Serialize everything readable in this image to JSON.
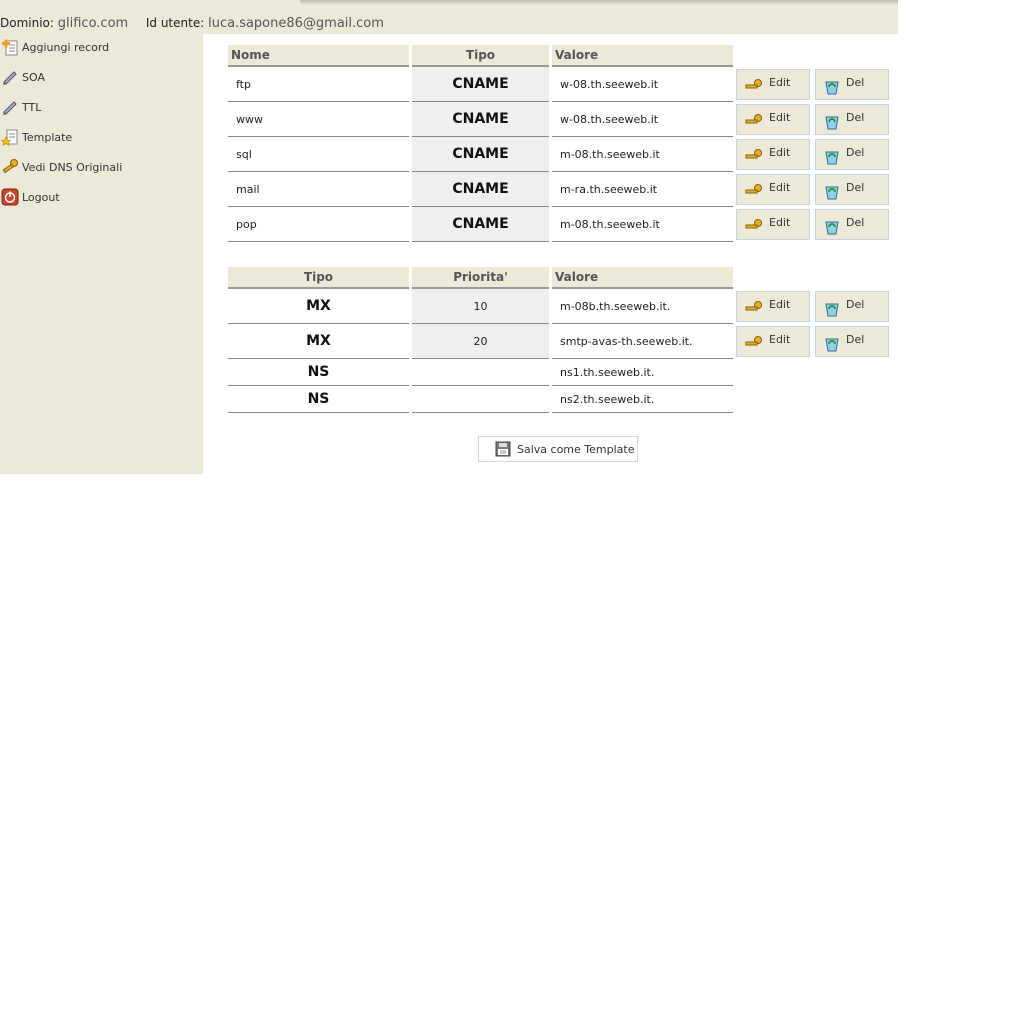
{
  "header": {
    "domain_label": "Dominio:",
    "domain_value": "glifico.com",
    "user_label": "Id utente:",
    "user_value": "luca.sapone86@gmail.com"
  },
  "sidebar": {
    "items": [
      {
        "label": "Aggiungi record",
        "icon": "add-record-icon"
      },
      {
        "label": "SOA",
        "icon": "pencil-icon"
      },
      {
        "label": "TTL",
        "icon": "pencil-icon"
      },
      {
        "label": "Template",
        "icon": "template-star-icon"
      },
      {
        "label": "Vedi DNS Originali",
        "icon": "key-icon"
      },
      {
        "label": "Logout",
        "icon": "power-icon"
      }
    ]
  },
  "cname_table": {
    "headers": [
      "Nome",
      "Tipo",
      "Valore"
    ],
    "rows": [
      {
        "nome": "ftp",
        "tipo": "CNAME",
        "valore": "w-08.th.seeweb.it"
      },
      {
        "nome": "www",
        "tipo": "CNAME",
        "valore": "w-08.th.seeweb.it"
      },
      {
        "nome": "sql",
        "tipo": "CNAME",
        "valore": "m-08.th.seeweb.it"
      },
      {
        "nome": "mail",
        "tipo": "CNAME",
        "valore": "m-ra.th.seeweb.it"
      },
      {
        "nome": "pop",
        "tipo": "CNAME",
        "valore": "m-08.th.seeweb.it"
      }
    ]
  },
  "mx_table": {
    "headers": [
      "Tipo",
      "Priorita'",
      "Valore"
    ],
    "rows": [
      {
        "tipo": "MX",
        "priorita": "10",
        "valore": "m-08b.th.seeweb.it."
      },
      {
        "tipo": "MX",
        "priorita": "20",
        "valore": "smtp-avas-th.seeweb.it."
      },
      {
        "tipo": "NS",
        "priorita": "",
        "valore": "ns1.th.seeweb.it."
      },
      {
        "tipo": "NS",
        "priorita": "",
        "valore": "ns2.th.seeweb.it."
      }
    ]
  },
  "buttons": {
    "edit_label": "Edit",
    "del_label": "Del",
    "save_template_label": "Salva come Template"
  }
}
